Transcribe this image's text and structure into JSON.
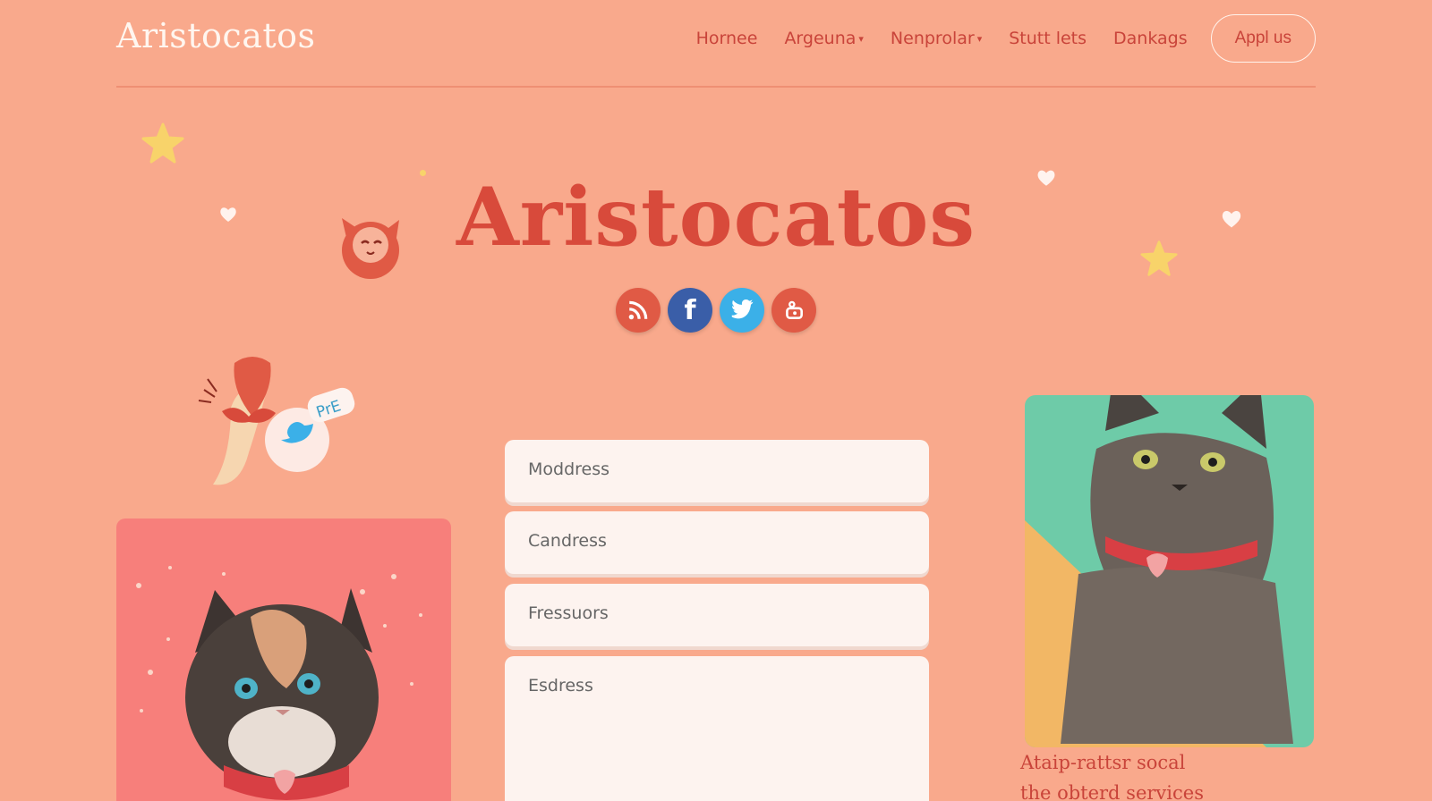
{
  "header": {
    "logo": "Aristocatos",
    "nav": [
      {
        "label": "Hornee",
        "dropdown": false
      },
      {
        "label": "Argeuna",
        "dropdown": true
      },
      {
        "label": "Nenprolar",
        "dropdown": true
      },
      {
        "label": "Stutt lets",
        "dropdown": false
      },
      {
        "label": "Dankags",
        "dropdown": false
      }
    ],
    "cta": "Appl us"
  },
  "hero": {
    "title": "Aristocatos",
    "social": [
      {
        "icon": "rss-icon",
        "color": "#e05a45",
        "glyph": ""
      },
      {
        "icon": "facebook-icon",
        "color": "#3a5ea8",
        "glyph": "f"
      },
      {
        "icon": "twitter-icon",
        "color": "#3bb0e8",
        "glyph": ""
      },
      {
        "icon": "instagram-icon",
        "color": "#e05a45",
        "glyph": ""
      }
    ],
    "sticker_text": "PrE"
  },
  "form": {
    "fields": [
      {
        "placeholder": "Moddress"
      },
      {
        "placeholder": "Candress"
      },
      {
        "placeholder": "Fressuors"
      },
      {
        "placeholder": "Esdress"
      }
    ]
  },
  "right_card": {
    "caption_line1": "Ataip-rattsr socal",
    "caption_line2": "the obterd services"
  },
  "colors": {
    "background": "#f9a98c",
    "accent": "#d84a3b",
    "nav_text": "#c9443a",
    "left_card": "#f77f7b",
    "right_card_teal": "#6ecba8",
    "right_card_yellow": "#f2b765"
  }
}
